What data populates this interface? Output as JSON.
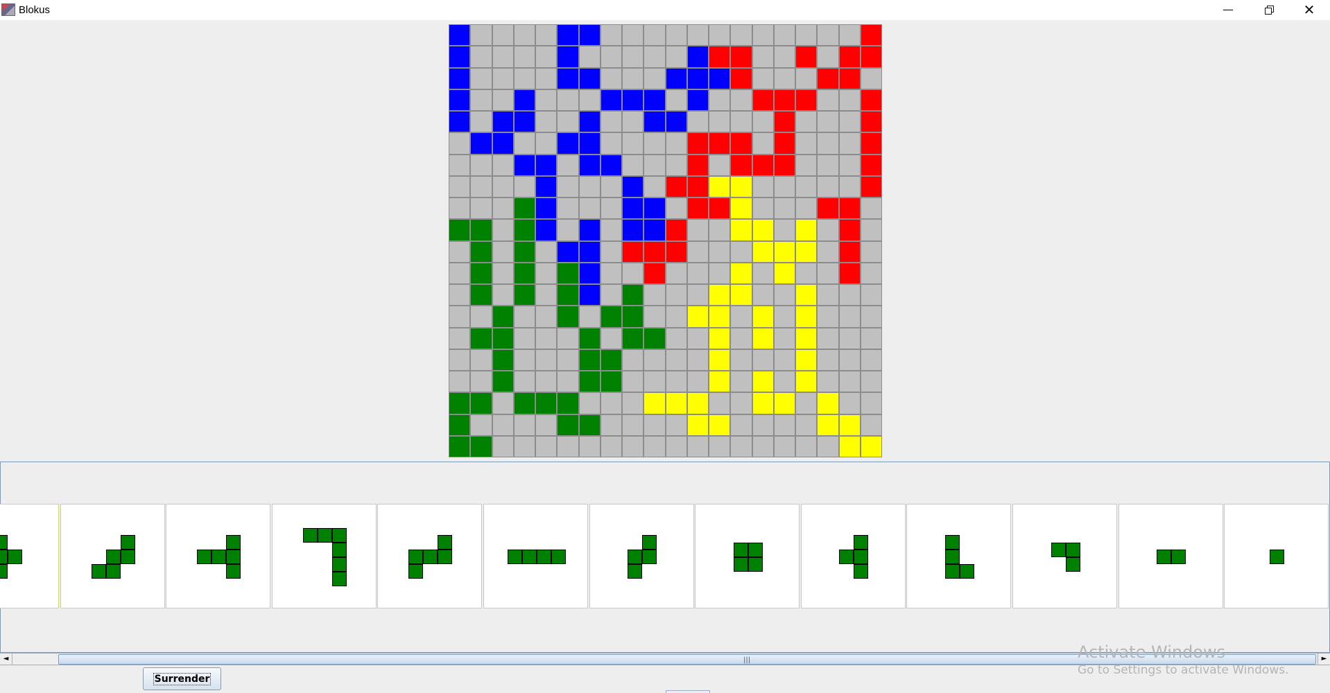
{
  "window": {
    "title": "Blokus",
    "minimize": "—",
    "close": "✕"
  },
  "colors": {
    "R": "#ff0000",
    "B": "#0000ff",
    "G": "#008000",
    "Y": "#ffff00",
    "E": "#c0c0c0"
  },
  "board": {
    "size": 20,
    "rows": [
      "BEEEEBBEEEEEEEEEEEER",
      "BEEEEBEEEEEBRREERERR",
      "BEEEEBBEEEBBBREEERRE",
      "BEEBEEEBBBEBEERRREER",
      "BEBBEEBEEBBEEEEREEER",
      "EBBEEBBEEEERRREREEER",
      "EEEBBEBBEEERERRREEER",
      "EEEEBEEEBERRYYEEEEER",
      "EEEGBEEEBBERRYEEERRE",
      "GGEGBEBEBBREEYYEYERE",
      "EGEGEBBERRREEEYYYERE",
      "EGEGEGBEEREEEYEYEERE",
      "EGEGEGBEGEEEYYEEYEEE",
      "EEGEEGEGGEEYYEYEYEEE",
      "EGGEEEGEGGEEYEYEYEEE",
      "EEGEEEGGEEEEYEEEYEEE",
      "EEGEEEGGEEEEYEYEYEEE",
      "GGEGGGEEEYYYEEYYEYEE",
      "GEEEEGGEEEEYYEEEEYYE",
      "GGEEEEEEEEEEEEEEEEYY"
    ]
  },
  "pieces": [
    {
      "cells": [
        [
          0,
          0
        ],
        [
          0,
          1
        ],
        [
          1,
          1
        ],
        [
          0,
          2
        ]
      ],
      "selected": true
    },
    {
      "cells": [
        [
          2,
          0
        ],
        [
          1,
          1
        ],
        [
          2,
          1
        ],
        [
          0,
          2
        ],
        [
          1,
          2
        ]
      ],
      "selected": false
    },
    {
      "cells": [
        [
          2,
          0
        ],
        [
          0,
          1
        ],
        [
          1,
          1
        ],
        [
          2,
          1
        ],
        [
          2,
          2
        ]
      ],
      "selected": false
    },
    {
      "cells": [
        [
          0,
          0
        ],
        [
          1,
          0
        ],
        [
          2,
          0
        ],
        [
          2,
          1
        ],
        [
          2,
          2
        ],
        [
          2,
          3
        ]
      ],
      "selected": false
    },
    {
      "cells": [
        [
          2,
          0
        ],
        [
          0,
          1
        ],
        [
          1,
          1
        ],
        [
          2,
          1
        ],
        [
          0,
          2
        ]
      ],
      "selected": false
    },
    {
      "cells": [
        [
          0,
          0
        ],
        [
          1,
          0
        ],
        [
          2,
          0
        ],
        [
          3,
          0
        ]
      ],
      "selected": false
    },
    {
      "cells": [
        [
          1,
          0
        ],
        [
          0,
          1
        ],
        [
          1,
          1
        ],
        [
          0,
          2
        ]
      ],
      "selected": false
    },
    {
      "cells": [
        [
          0,
          0
        ],
        [
          1,
          0
        ],
        [
          0,
          1
        ],
        [
          1,
          1
        ]
      ],
      "selected": false
    },
    {
      "cells": [
        [
          1,
          0
        ],
        [
          0,
          1
        ],
        [
          1,
          1
        ],
        [
          1,
          2
        ]
      ],
      "selected": false
    },
    {
      "cells": [
        [
          0,
          0
        ],
        [
          0,
          1
        ],
        [
          0,
          2
        ],
        [
          1,
          2
        ]
      ],
      "selected": false
    },
    {
      "cells": [
        [
          0,
          0
        ],
        [
          1,
          0
        ],
        [
          1,
          1
        ]
      ],
      "selected": false
    },
    {
      "cells": [
        [
          0,
          0
        ],
        [
          1,
          0
        ]
      ],
      "selected": false
    },
    {
      "cells": [
        [
          0,
          0
        ]
      ],
      "selected": false
    }
  ],
  "scrollbar": {
    "left": "◄",
    "right": "►",
    "grip": "|||"
  },
  "surrender_label": "Surrender",
  "watermark": {
    "line1": "Activate Windows",
    "line2": "Go to Settings to activate Windows."
  }
}
